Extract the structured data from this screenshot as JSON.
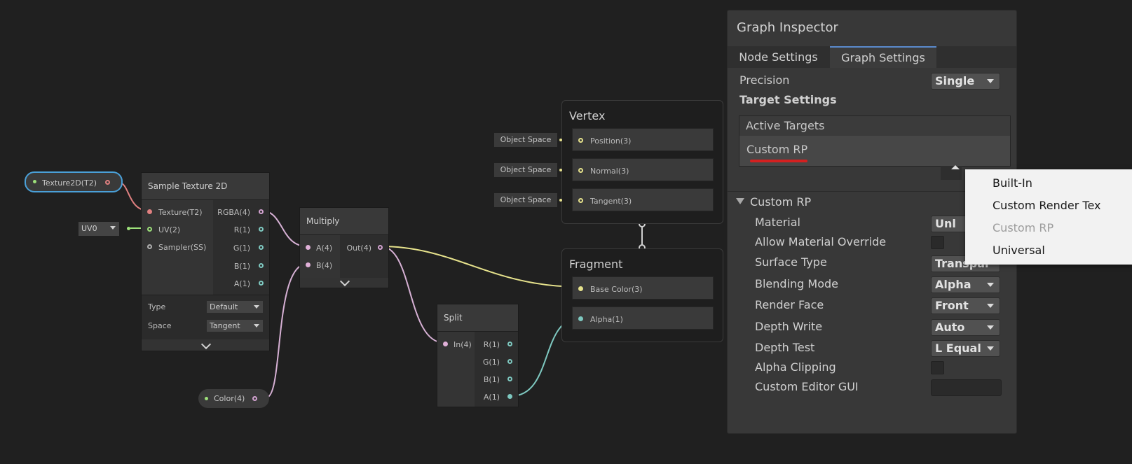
{
  "graph": {
    "texture_property": "Texture2D(T2)",
    "color_property": "Color(4)",
    "uv_dropdown": "UV0",
    "sample_node": {
      "title": "Sample Texture 2D",
      "inputs": [
        "Texture(T2)",
        "UV(2)",
        "Sampler(SS)"
      ],
      "outputs": [
        "RGBA(4)",
        "R(1)",
        "G(1)",
        "B(1)",
        "A(1)"
      ],
      "type_label": "Type",
      "type_value": "Default",
      "space_label": "Space",
      "space_value": "Tangent"
    },
    "multiply_node": {
      "title": "Multiply",
      "inputs": [
        "A(4)",
        "B(4)"
      ],
      "output": "Out(4)"
    },
    "split_node": {
      "title": "Split",
      "input": "In(4)",
      "outputs": [
        "R(1)",
        "G(1)",
        "B(1)",
        "A(1)"
      ]
    },
    "vertex_block": {
      "title": "Vertex",
      "slots": [
        "Position(3)",
        "Normal(3)",
        "Tangent(3)"
      ],
      "space_tags": [
        "Object Space",
        "Object Space",
        "Object Space"
      ]
    },
    "fragment_block": {
      "title": "Fragment",
      "slots": [
        "Base Color(3)",
        "Alpha(1)"
      ]
    }
  },
  "inspector": {
    "title": "Graph Inspector",
    "tabs": [
      "Node Settings",
      "Graph Settings"
    ],
    "active_tab": "Graph Settings",
    "precision_label": "Precision",
    "precision_value": "Single",
    "target_settings_label": "Target Settings",
    "active_targets_label": "Active Targets",
    "active_target_item": "Custom RP",
    "section_title": "Custom RP",
    "properties": [
      {
        "label": "Material",
        "value": "Unl"
      },
      {
        "label": "Allow Material Override",
        "value": ""
      },
      {
        "label": "Surface Type",
        "value": "Transpar"
      },
      {
        "label": "Blending Mode",
        "value": "Alpha"
      },
      {
        "label": "Render Face",
        "value": "Front"
      },
      {
        "label": "Depth Write",
        "value": "Auto"
      },
      {
        "label": "Depth Test",
        "value": "L Equal"
      },
      {
        "label": "Alpha Clipping",
        "value": ""
      },
      {
        "label": "Custom Editor GUI",
        "value": ""
      }
    ]
  },
  "popup": {
    "items": [
      "Built-In",
      "Custom Render Tex",
      "Custom RP",
      "Universal"
    ]
  },
  "colors": {
    "background": "#202020",
    "panel": "#383838",
    "tab_accent": "#5a8acc",
    "underline_red": "#d42020",
    "wire_pink": "#d6b0d4",
    "wire_yellow": "#e6e28c",
    "wire_cyan": "#7ec8c0",
    "wire_red": "#e08080",
    "selection_blue": "#4aa0d8"
  }
}
